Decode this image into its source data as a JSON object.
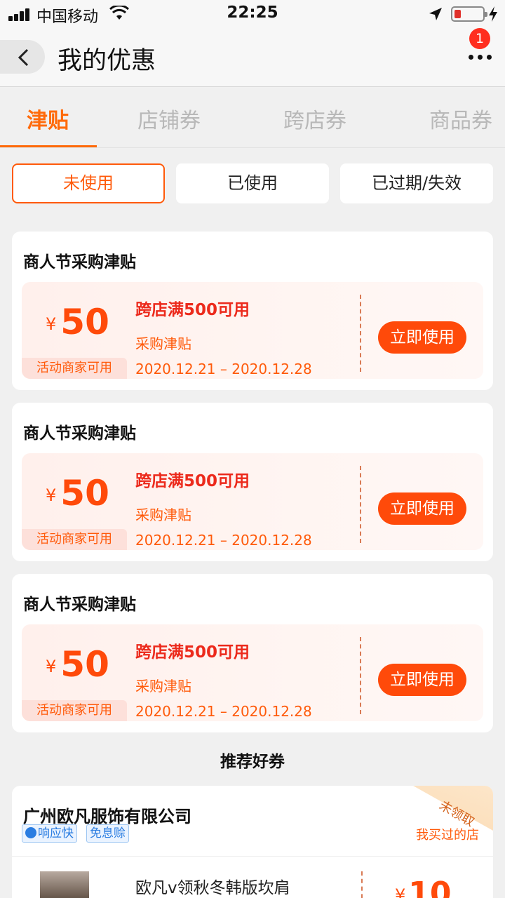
{
  "status_bar": {
    "carrier": "中国移动",
    "time": "22:25"
  },
  "header": {
    "title": "我的优惠",
    "notification_count": "1"
  },
  "tabs": [
    {
      "label": "津贴",
      "active": true
    },
    {
      "label": "店铺券",
      "active": false
    },
    {
      "label": "跨店券",
      "active": false
    },
    {
      "label": "商品券",
      "active": false
    }
  ],
  "filters": [
    {
      "label": "未使用",
      "active": true
    },
    {
      "label": "已使用",
      "active": false
    },
    {
      "label": "已过期/失效",
      "active": false
    }
  ],
  "coupons": [
    {
      "title": "商人节采购津贴",
      "currency": "¥",
      "amount": "50",
      "merchant_tag": "活动商家可用",
      "condition": "跨店满500可用",
      "subtitle": "采购津贴",
      "valid_dates": "2020.12.21 – 2020.12.28",
      "action": "立即使用"
    },
    {
      "title": "商人节采购津贴",
      "currency": "¥",
      "amount": "50",
      "merchant_tag": "活动商家可用",
      "condition": "跨店满500可用",
      "subtitle": "采购津贴",
      "valid_dates": "2020.12.21 – 2020.12.28",
      "action": "立即使用"
    },
    {
      "title": "商人节采购津贴",
      "currency": "¥",
      "amount": "50",
      "merchant_tag": "活动商家可用",
      "condition": "跨店满500可用",
      "subtitle": "采购津贴",
      "valid_dates": "2020.12.21 – 2020.12.28",
      "action": "立即使用"
    }
  ],
  "recommend": {
    "title": "推荐好券",
    "shop": {
      "name": "广州欧凡服饰有限公司",
      "tags": [
        "响应快",
        "免息赊"
      ],
      "bought_link": "我买过的店",
      "ribbon": "未领取",
      "product_name": "欧凡v领秋冬韩版坎肩",
      "currency": "¥",
      "amount": "10"
    }
  },
  "colors": {
    "accent": "#ff6a0a",
    "button": "#ff4a0a",
    "condition_text": "#ec2a1c",
    "badge": "#ff2e1f",
    "tag_blue": "#2a7de1"
  }
}
